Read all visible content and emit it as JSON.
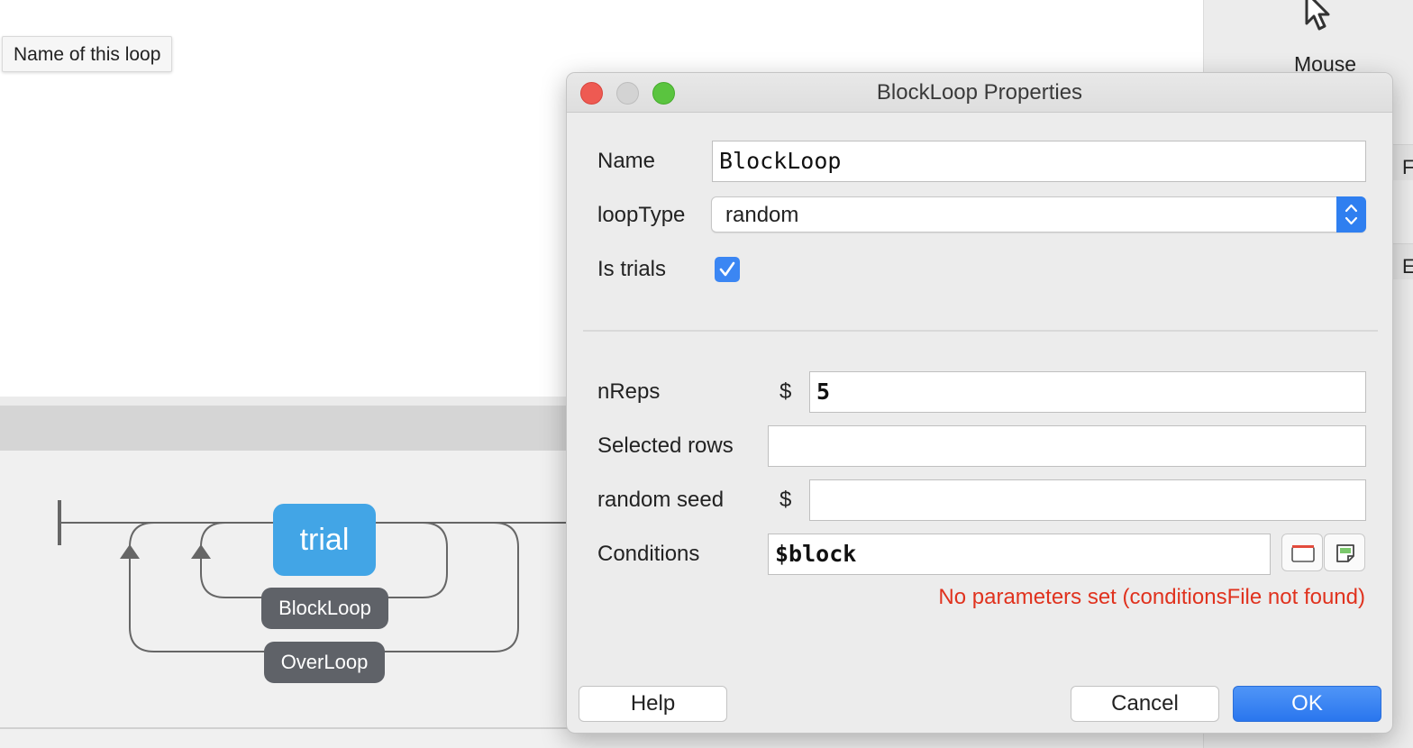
{
  "tooltip": {
    "text": "Name of this loop"
  },
  "right_panel": {
    "component_label": "Mouse",
    "component_icon": "mouse-cursor-icon",
    "edge_letters": [
      "F",
      "E"
    ]
  },
  "flow": {
    "routine": "trial",
    "inner_loop": "BlockLoop",
    "outer_loop": "OverLoop"
  },
  "dialog": {
    "title": "BlockLoop Properties",
    "fields": {
      "name": {
        "label": "Name",
        "value": "BlockLoop"
      },
      "loop_type": {
        "label": "loopType",
        "value": "random"
      },
      "is_trials": {
        "label": "Is trials",
        "checked": true
      },
      "nreps": {
        "label": "nReps",
        "prefix": "$",
        "value": "5"
      },
      "selected_rows": {
        "label": "Selected rows",
        "value": ""
      },
      "random_seed": {
        "label": "random seed",
        "prefix": "$",
        "value": ""
      },
      "conditions": {
        "label": "Conditions",
        "value": "$block"
      }
    },
    "error_message": "No parameters set (conditionsFile not found)",
    "buttons": {
      "help": "Help",
      "cancel": "Cancel",
      "ok": "OK"
    }
  },
  "colors": {
    "routine": "#42a5e6",
    "loop_pill": "#5f6268",
    "error": "#e0321e",
    "primary_button": "#2a76ee",
    "checkbox": "#3b86f3"
  }
}
